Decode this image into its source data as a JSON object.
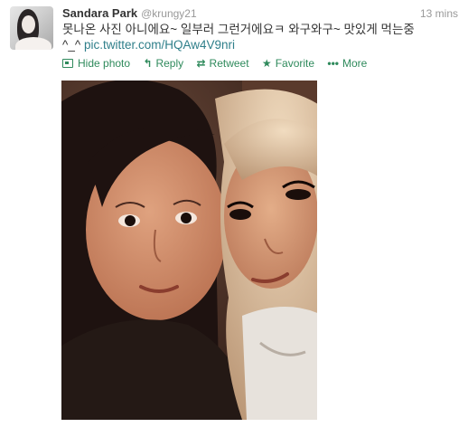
{
  "tweet": {
    "author_name": "Sandara Park",
    "author_handle": "@krungy21",
    "timestamp": "13 mins",
    "text_line1": "못나온 사진 아니에요~ 일부러 그런거에요ㅋ 와구와구~ 맛있게 먹는중",
    "text_line2_prefix": "^_^ ",
    "link": "pic.twitter.com/HQAw4V9nri"
  },
  "actions": {
    "hide_photo": "Hide photo",
    "reply": "Reply",
    "retweet": "Retweet",
    "favorite": "Favorite",
    "more": "More"
  },
  "icons": {
    "avatar": "profile-photo",
    "hide_photo": "photo-icon",
    "reply": "reply-arrow-icon",
    "retweet": "retweet-icon",
    "favorite": "star-icon",
    "more": "ellipsis-icon"
  },
  "colors": {
    "name": "#333333",
    "meta": "#999999",
    "link": "#2f7f8a",
    "action": "#2f8a5c"
  }
}
